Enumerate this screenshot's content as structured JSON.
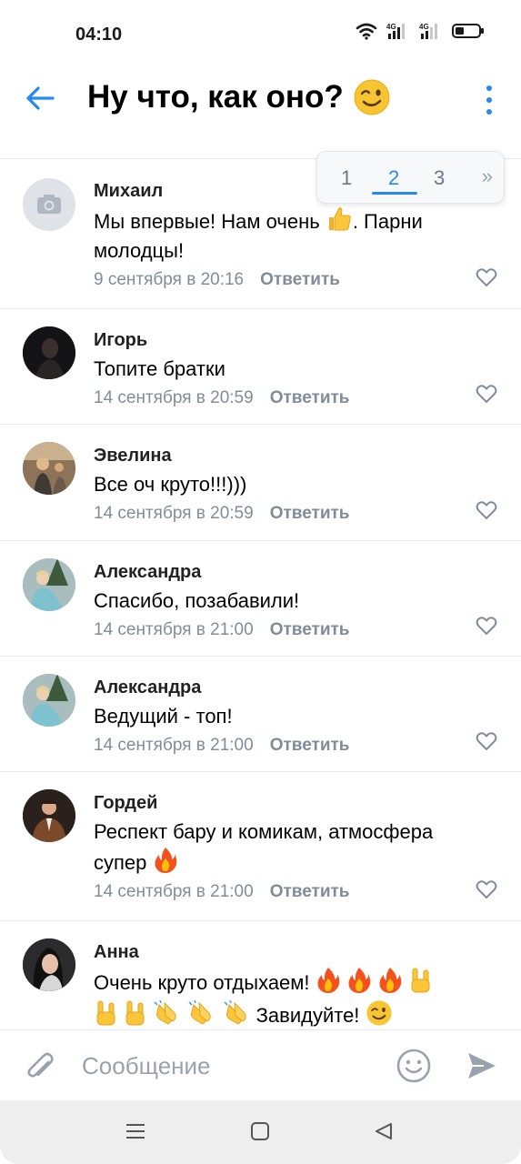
{
  "status_bar": {
    "time": "04:10",
    "icons": [
      "wifi-icon",
      "signal-4g-icon",
      "signal-4g-icon",
      "battery-icon"
    ],
    "network_labels": [
      "4G",
      "4G"
    ]
  },
  "header": {
    "back_icon": "arrow-left-icon",
    "title": "Ну что, как оно?",
    "title_emoji": "winking-face-icon",
    "menu_icon": "more-vertical-icon"
  },
  "pagination": {
    "pages": [
      "1",
      "2",
      "3"
    ],
    "current": "2",
    "next_label": "»"
  },
  "comments": [
    {
      "name": "Михаил",
      "text": "Мы впервые! Нам очень [thumbs-up-icon]. Парни молодцы!",
      "text_parts": [
        "Мы впервые! Нам очень ",
        ". Парни молодцы!"
      ],
      "date": "9 сентября в 20:16",
      "reply_label": "Ответить",
      "avatar": "camera-placeholder-avatar"
    },
    {
      "name": "Игорь",
      "text": "Топите братки",
      "date": "14 сентября в 20:59",
      "reply_label": "Ответить",
      "avatar": "photo-avatar"
    },
    {
      "name": "Эвелина",
      "text": "Все оч круто!!!)))",
      "date": "14 сентября в 20:59",
      "reply_label": "Ответить",
      "avatar": "photo-avatar"
    },
    {
      "name": "Александра",
      "text": "Спасибо, позабавили!",
      "date": "14 сентября в 21:00",
      "reply_label": "Ответить",
      "avatar": "photo-avatar"
    },
    {
      "name": "Александра",
      "text": "Ведущий - топ!",
      "date": "14 сентября в 21:00",
      "reply_label": "Ответить",
      "avatar": "photo-avatar"
    },
    {
      "name": "Гордей",
      "text": "Респект бару и комикам, атмосфера супер [fire-icon]",
      "text_parts": [
        "Респект бару и комикам, атмосфера супер "
      ],
      "date": "14 сентября в 21:00",
      "reply_label": "Ответить",
      "avatar": "photo-avatar"
    },
    {
      "name": "Анна",
      "text": "Очень круто отдыхаем! [fire-icon][fire-icon][fire-icon][rock-hand-icon][rock-hand-icon][rock-hand-icon][clapping-hands-icon][clapping-hands-icon][clapping-hands-icon] Завидуйте! [winking-face-icon]",
      "text_parts": [
        "Очень круто отдыхаем! ",
        " Завидуйте! "
      ],
      "avatar": "photo-avatar"
    }
  ],
  "composer": {
    "placeholder": "Сообщение",
    "attach_icon": "paperclip-icon",
    "emoji_icon": "smiley-icon",
    "send_icon": "send-icon"
  },
  "nav_bar": {
    "icons": [
      "menu-icon",
      "home-square-icon",
      "back-triangle-icon"
    ]
  },
  "colors": {
    "accent": "#2787f5",
    "meta_text": "#818c99",
    "divider": "#e7e8ec"
  }
}
